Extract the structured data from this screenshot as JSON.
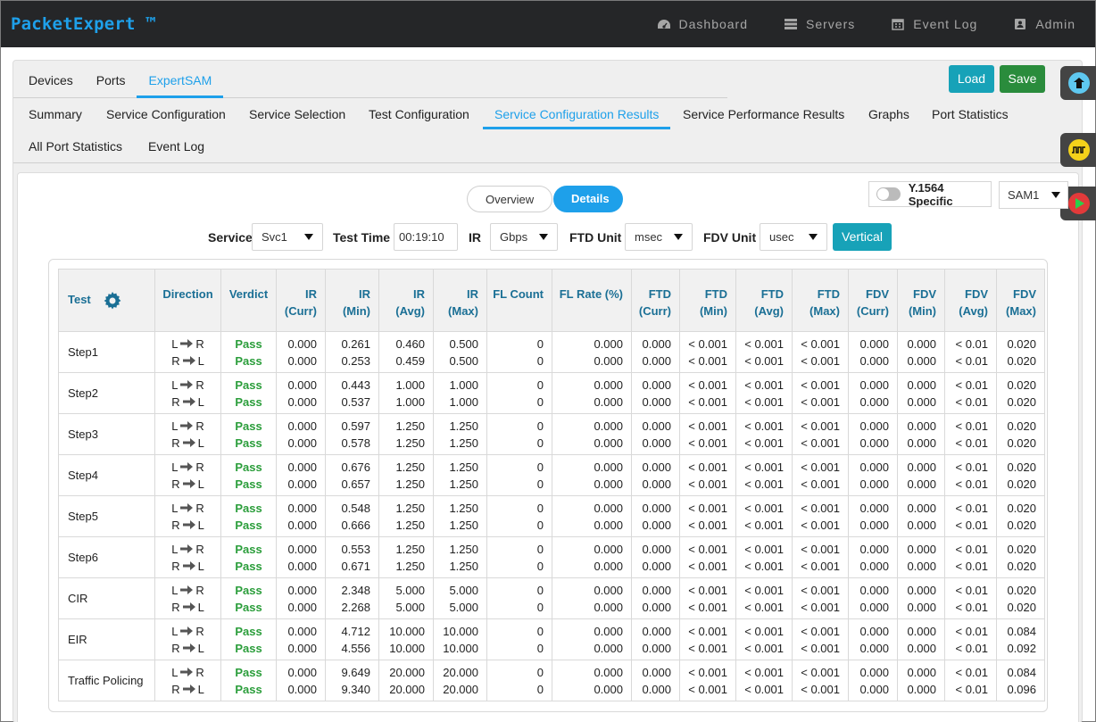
{
  "brand": "PacketExpert ™",
  "nav": [
    {
      "label": "Dashboard",
      "icon": "dashboard-icon"
    },
    {
      "label": "Servers",
      "icon": "servers-icon"
    },
    {
      "label": "Event Log",
      "icon": "calendar-icon"
    },
    {
      "label": "Admin",
      "icon": "admin-icon"
    }
  ],
  "tabs1": [
    "Devices",
    "Ports",
    "ExpertSAM"
  ],
  "tabs1_active": "ExpertSAM",
  "buttons": {
    "load": "Load",
    "save": "Save",
    "vertical": "Vertical"
  },
  "tabs2": [
    "Summary",
    "Service Configuration",
    "Service Selection",
    "Test Configuration",
    "Service Configuration Results",
    "Service Performance Results",
    "Graphs",
    "Port Statistics",
    "All Port Statistics",
    "Event Log"
  ],
  "tabs2_active": "Service Configuration Results",
  "view_toggle": {
    "overview": "Overview",
    "details": "Details",
    "active": "Details"
  },
  "y1564": {
    "label": "Y.1564 Specific",
    "enabled": false
  },
  "sam_select": "SAM1",
  "filters": {
    "service_label": "Service",
    "service_value": "Svc1",
    "test_time_label": "Test Time",
    "test_time_value": "00:19:10",
    "ir_label": "IR",
    "ir_value": "Gbps",
    "ftd_label": "FTD Unit",
    "ftd_value": "msec",
    "fdv_label": "FDV Unit",
    "fdv_value": "usec"
  },
  "table": {
    "headers": [
      [
        "Test"
      ],
      [
        "Direction"
      ],
      [
        "Verdict"
      ],
      [
        "IR",
        "(Curr)"
      ],
      [
        "IR",
        "(Min)"
      ],
      [
        "IR",
        "(Avg)"
      ],
      [
        "IR",
        "(Max)"
      ],
      [
        "FL Count"
      ],
      [
        "FL Rate (%)"
      ],
      [
        "FTD",
        "(Curr)"
      ],
      [
        "FTD",
        "(Min)"
      ],
      [
        "FTD",
        "(Avg)"
      ],
      [
        "FTD",
        "(Max)"
      ],
      [
        "FDV",
        "(Curr)"
      ],
      [
        "FDV",
        "(Min)"
      ],
      [
        "FDV",
        "(Avg)"
      ],
      [
        "FDV",
        "(Max)"
      ]
    ],
    "rows": [
      {
        "test": "Step1",
        "data": [
          [
            "L",
            "R",
            "Pass",
            "0.000",
            "0.261",
            "0.460",
            "0.500",
            "0",
            "0.000",
            "0.000",
            "< 0.001",
            "< 0.001",
            "< 0.001",
            "0.000",
            "0.000",
            "< 0.01",
            "0.020"
          ],
          [
            "R",
            "L",
            "Pass",
            "0.000",
            "0.253",
            "0.459",
            "0.500",
            "0",
            "0.000",
            "0.000",
            "< 0.001",
            "< 0.001",
            "< 0.001",
            "0.000",
            "0.000",
            "< 0.01",
            "0.020"
          ]
        ]
      },
      {
        "test": "Step2",
        "data": [
          [
            "L",
            "R",
            "Pass",
            "0.000",
            "0.443",
            "1.000",
            "1.000",
            "0",
            "0.000",
            "0.000",
            "< 0.001",
            "< 0.001",
            "< 0.001",
            "0.000",
            "0.000",
            "< 0.01",
            "0.020"
          ],
          [
            "R",
            "L",
            "Pass",
            "0.000",
            "0.537",
            "1.000",
            "1.000",
            "0",
            "0.000",
            "0.000",
            "< 0.001",
            "< 0.001",
            "< 0.001",
            "0.000",
            "0.000",
            "< 0.01",
            "0.020"
          ]
        ]
      },
      {
        "test": "Step3",
        "data": [
          [
            "L",
            "R",
            "Pass",
            "0.000",
            "0.597",
            "1.250",
            "1.250",
            "0",
            "0.000",
            "0.000",
            "< 0.001",
            "< 0.001",
            "< 0.001",
            "0.000",
            "0.000",
            "< 0.01",
            "0.020"
          ],
          [
            "R",
            "L",
            "Pass",
            "0.000",
            "0.578",
            "1.250",
            "1.250",
            "0",
            "0.000",
            "0.000",
            "< 0.001",
            "< 0.001",
            "< 0.001",
            "0.000",
            "0.000",
            "< 0.01",
            "0.020"
          ]
        ]
      },
      {
        "test": "Step4",
        "data": [
          [
            "L",
            "R",
            "Pass",
            "0.000",
            "0.676",
            "1.250",
            "1.250",
            "0",
            "0.000",
            "0.000",
            "< 0.001",
            "< 0.001",
            "< 0.001",
            "0.000",
            "0.000",
            "< 0.01",
            "0.020"
          ],
          [
            "R",
            "L",
            "Pass",
            "0.000",
            "0.657",
            "1.250",
            "1.250",
            "0",
            "0.000",
            "0.000",
            "< 0.001",
            "< 0.001",
            "< 0.001",
            "0.000",
            "0.000",
            "< 0.01",
            "0.020"
          ]
        ]
      },
      {
        "test": "Step5",
        "data": [
          [
            "L",
            "R",
            "Pass",
            "0.000",
            "0.548",
            "1.250",
            "1.250",
            "0",
            "0.000",
            "0.000",
            "< 0.001",
            "< 0.001",
            "< 0.001",
            "0.000",
            "0.000",
            "< 0.01",
            "0.020"
          ],
          [
            "R",
            "L",
            "Pass",
            "0.000",
            "0.666",
            "1.250",
            "1.250",
            "0",
            "0.000",
            "0.000",
            "< 0.001",
            "< 0.001",
            "< 0.001",
            "0.000",
            "0.000",
            "< 0.01",
            "0.020"
          ]
        ]
      },
      {
        "test": "Step6",
        "data": [
          [
            "L",
            "R",
            "Pass",
            "0.000",
            "0.553",
            "1.250",
            "1.250",
            "0",
            "0.000",
            "0.000",
            "< 0.001",
            "< 0.001",
            "< 0.001",
            "0.000",
            "0.000",
            "< 0.01",
            "0.020"
          ],
          [
            "R",
            "L",
            "Pass",
            "0.000",
            "0.671",
            "1.250",
            "1.250",
            "0",
            "0.000",
            "0.000",
            "< 0.001",
            "< 0.001",
            "< 0.001",
            "0.000",
            "0.000",
            "< 0.01",
            "0.020"
          ]
        ]
      },
      {
        "test": "CIR",
        "data": [
          [
            "L",
            "R",
            "Pass",
            "0.000",
            "2.348",
            "5.000",
            "5.000",
            "0",
            "0.000",
            "0.000",
            "< 0.001",
            "< 0.001",
            "< 0.001",
            "0.000",
            "0.000",
            "< 0.01",
            "0.020"
          ],
          [
            "R",
            "L",
            "Pass",
            "0.000",
            "2.268",
            "5.000",
            "5.000",
            "0",
            "0.000",
            "0.000",
            "< 0.001",
            "< 0.001",
            "< 0.001",
            "0.000",
            "0.000",
            "< 0.01",
            "0.020"
          ]
        ]
      },
      {
        "test": "EIR",
        "data": [
          [
            "L",
            "R",
            "Pass",
            "0.000",
            "4.712",
            "10.000",
            "10.000",
            "0",
            "0.000",
            "0.000",
            "< 0.001",
            "< 0.001",
            "< 0.001",
            "0.000",
            "0.000",
            "< 0.01",
            "0.084"
          ],
          [
            "R",
            "L",
            "Pass",
            "0.000",
            "4.556",
            "10.000",
            "10.000",
            "0",
            "0.000",
            "0.000",
            "< 0.001",
            "< 0.001",
            "< 0.001",
            "0.000",
            "0.000",
            "< 0.01",
            "0.092"
          ]
        ]
      },
      {
        "test": "Traffic Policing",
        "data": [
          [
            "L",
            "R",
            "Pass",
            "0.000",
            "9.649",
            "20.000",
            "20.000",
            "0",
            "0.000",
            "0.000",
            "< 0.001",
            "< 0.001",
            "< 0.001",
            "0.000",
            "0.000",
            "< 0.01",
            "0.084"
          ],
          [
            "R",
            "L",
            "Pass",
            "0.000",
            "9.340",
            "20.000",
            "20.000",
            "0",
            "0.000",
            "0.000",
            "< 0.001",
            "< 0.001",
            "< 0.001",
            "0.000",
            "0.000",
            "< 0.01",
            "0.096"
          ]
        ]
      }
    ]
  },
  "colors": {
    "accent": "#1ea0ea",
    "pass": "#2a9d3a",
    "header_text": "#1a6f95",
    "load": "#17a2b8",
    "save": "#2a8c3c",
    "navbar": "#252628"
  },
  "side_buttons": [
    "network-icon",
    "waveform-icon",
    "play-icon"
  ]
}
